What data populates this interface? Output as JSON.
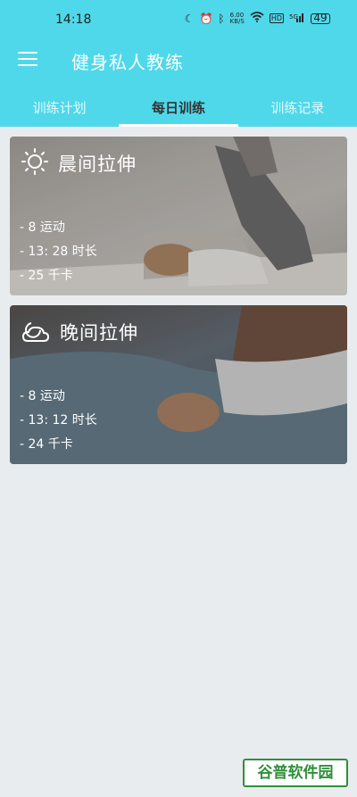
{
  "status_bar": {
    "time": "14:18",
    "network_speed": "6.00\nKB/S",
    "signal_label": "5G",
    "battery": "49"
  },
  "app_bar": {
    "title": "健身私人教练",
    "menu_icon": "hamburger-menu-icon"
  },
  "tabs": [
    {
      "label": "训练计划",
      "active": false
    },
    {
      "label": "每日训练",
      "active": true
    },
    {
      "label": "训练记录",
      "active": false
    }
  ],
  "cards": [
    {
      "title": "晨间拉伸",
      "icon": "sun-icon",
      "stats": [
        "- 8 运动",
        "- 13: 28 时长",
        "- 25 千卡"
      ]
    },
    {
      "title": "晚间拉伸",
      "icon": "moon-cloud-icon",
      "stats": [
        "- 8 运动",
        "- 13: 12 时长",
        "- 24 千卡"
      ]
    }
  ],
  "watermark": "谷普软件园",
  "colors": {
    "header": "#4fd8ea",
    "background": "#e9ecef",
    "watermark": "#2f8f3a"
  }
}
